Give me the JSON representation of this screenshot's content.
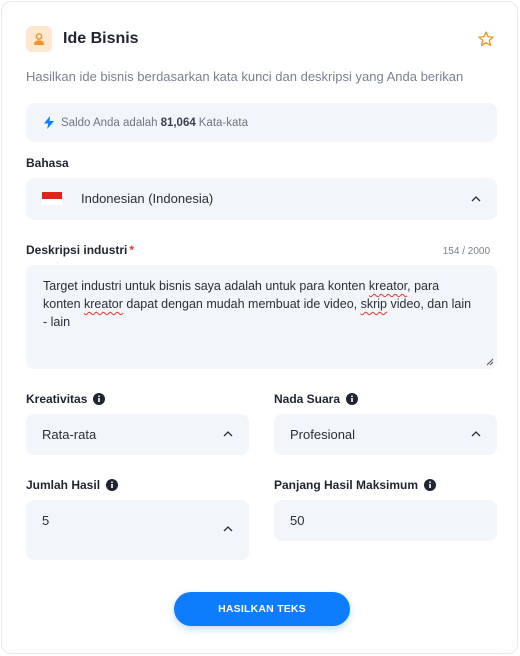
{
  "header": {
    "title": "Ide Bisnis",
    "icon": "user-badge-icon",
    "star_icon": "star-outline-icon"
  },
  "subtitle": "Hasilkan ide bisnis berdasarkan kata kunci dan deskripsi yang Anda berikan",
  "balance": {
    "prefix": "Saldo Anda adalah",
    "amount": "81,064",
    "suffix": "Kata-kata"
  },
  "language": {
    "label": "Bahasa",
    "value": "Indonesian (Indonesia)"
  },
  "description": {
    "label": "Deskripsi industri",
    "required_mark": "*",
    "counter": "154 / 2000",
    "seg1": "Target industri untuk bisnis saya adalah untuk para konten ",
    "word1": "kreator",
    "seg2": ", para konten ",
    "word2": "kreator",
    "seg3": " dapat dengan mudah membuat ide video, ",
    "word3": "skrip",
    "seg4": " video, dan lain - lain"
  },
  "creativity": {
    "label": "Kreativitas",
    "value": "Rata-rata"
  },
  "tone": {
    "label": "Nada Suara",
    "value": "Profesional"
  },
  "results": {
    "label": "Jumlah Hasil",
    "value": "5"
  },
  "max_length": {
    "label": "Panjang Hasil Maksimum",
    "value": "50"
  },
  "submit": {
    "label": "HASILKAN TEKS"
  },
  "colors": {
    "accent": "#0d7dfd",
    "icon_bg": "#fde8cf",
    "icon_fg": "#f0952a",
    "required": "#e53935"
  }
}
